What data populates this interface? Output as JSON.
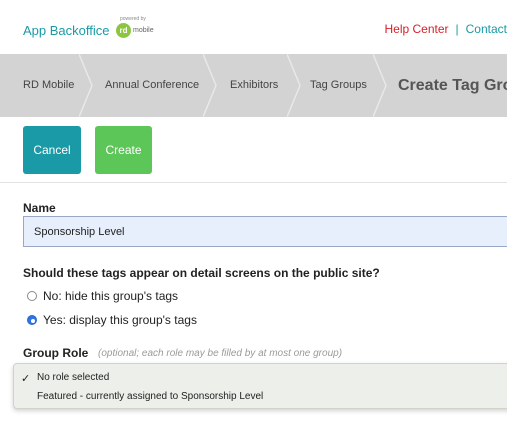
{
  "header": {
    "brand": "App Backoffice",
    "powered_by": "powered by",
    "logo_rd": "rd",
    "logo_mobile": "mobile",
    "help_link": "Help Center",
    "separator": "|",
    "contact_link": "Contact"
  },
  "breadcrumb": {
    "items": [
      "RD Mobile",
      "Annual Conference",
      "Exhibitors",
      "Tag Groups"
    ],
    "current": "Create Tag Group"
  },
  "actions": {
    "cancel_label": "Cancel",
    "create_label": "Create"
  },
  "form": {
    "name_label": "Name",
    "name_value": "Sponsorship Level",
    "question": "Should these tags appear on detail screens on the public site?",
    "options": [
      {
        "label": "No: hide this group's tags",
        "selected": false
      },
      {
        "label": "Yes: display this group's tags",
        "selected": true
      }
    ],
    "group_role_label": "Group Role",
    "group_role_hint": "(optional; each role may be filled by at most one group)",
    "role_options": [
      {
        "label": "No role selected",
        "checked": true
      },
      {
        "label": "Featured - currently assigned to Sponsorship Level",
        "checked": false
      }
    ]
  },
  "colors": {
    "teal": "#1a9aa6",
    "green": "#5cc659",
    "help_red": "#d7202a",
    "crumb_bg": "#d3d3d3"
  }
}
